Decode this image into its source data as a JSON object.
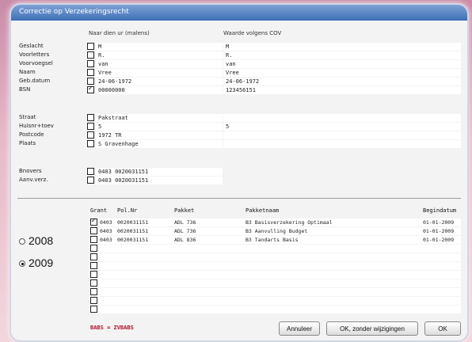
{
  "window": {
    "title": "Correctie op Verzekeringsrecht"
  },
  "columns": {
    "left": "Naar dien ur (malens)",
    "right": "Waarde volgens COV"
  },
  "person": [
    {
      "label": "Geslacht",
      "checked": false,
      "left": "M",
      "right": "M"
    },
    {
      "label": "Voorletters",
      "checked": false,
      "left": "R.",
      "right": "R."
    },
    {
      "label": "Voorvoegsel",
      "checked": false,
      "left": "van",
      "right": "van"
    },
    {
      "label": "Naam",
      "checked": false,
      "left": "Vree",
      "right": "Vree"
    },
    {
      "label": "Geb.datum",
      "checked": false,
      "left": "24-06-1972",
      "right": "24-06-1972"
    },
    {
      "label": "BSN",
      "checked": true,
      "left": "00000000",
      "right": "123456151"
    }
  ],
  "address": [
    {
      "label": "Straat",
      "checked": false,
      "left": "Pakstraat",
      "right": ""
    },
    {
      "label": "Huisnr+toev",
      "checked": false,
      "left": "5",
      "right": "5"
    },
    {
      "label": "Postcode",
      "checked": false,
      "left": "1972 TR",
      "right": ""
    },
    {
      "label": "Plaats",
      "checked": false,
      "left": "S Gravenhage",
      "right": ""
    }
  ],
  "accounts": [
    {
      "label": "Bnovers",
      "value": "0403   0020031151"
    },
    {
      "label": "Aanv.verz.",
      "value": "0403   0020031151"
    }
  ],
  "years": [
    {
      "label": "2008",
      "selected": false
    },
    {
      "label": "2009",
      "selected": true
    }
  ],
  "table": {
    "headers": [
      "Grant",
      "Pol.Nr",
      "Pakket",
      "Pakketnaam",
      "Begindatum"
    ],
    "rows": [
      {
        "checked": true,
        "grant": "0403",
        "polnr": "0020031151",
        "pakket": "ADL 736",
        "naam": "B3 Basisverzekering Optimaal",
        "datum": "01-01-2009"
      },
      {
        "checked": false,
        "grant": "0403",
        "polnr": "0020031151",
        "pakket": "ADL 736",
        "naam": "B3 Aanvulling Budget",
        "datum": "01-01-2009"
      },
      {
        "checked": false,
        "grant": "0403",
        "polnr": "0020031151",
        "pakket": "ADL 836",
        "naam": "B3 Tandarts Basis",
        "datum": "01-01-2009"
      },
      {
        "checked": false,
        "grant": "",
        "polnr": "",
        "pakket": "",
        "naam": "",
        "datum": ""
      },
      {
        "checked": false,
        "grant": "",
        "polnr": "",
        "pakket": "",
        "naam": "",
        "datum": ""
      },
      {
        "checked": false,
        "grant": "",
        "polnr": "",
        "pakket": "",
        "naam": "",
        "datum": ""
      },
      {
        "checked": false,
        "grant": "",
        "polnr": "",
        "pakket": "",
        "naam": "",
        "datum": ""
      },
      {
        "checked": false,
        "grant": "",
        "polnr": "",
        "pakket": "",
        "naam": "",
        "datum": ""
      },
      {
        "checked": false,
        "grant": "",
        "polnr": "",
        "pakket": "",
        "naam": "",
        "datum": ""
      },
      {
        "checked": false,
        "grant": "",
        "polnr": "",
        "pakket": "",
        "naam": "",
        "datum": ""
      },
      {
        "checked": false,
        "grant": "",
        "polnr": "",
        "pakket": "",
        "naam": "",
        "datum": ""
      }
    ]
  },
  "footer": {
    "note": "BABS = ZVBABS",
    "cancel": "Annuleer",
    "ok_no_changes": "OK, zonder wijzigingen",
    "ok": "OK"
  }
}
